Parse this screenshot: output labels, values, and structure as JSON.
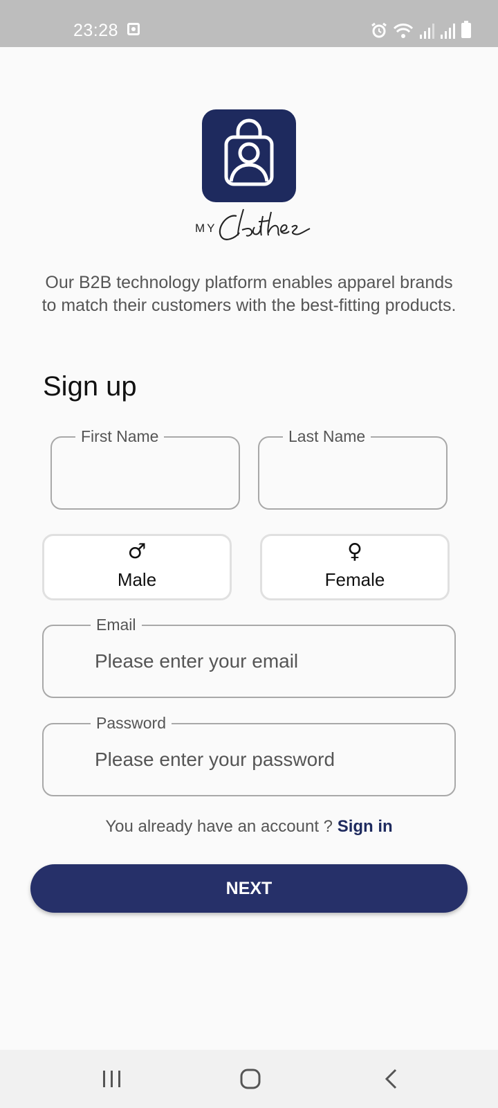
{
  "status_bar": {
    "time": "23:28",
    "icons": [
      "notification-icon",
      "alarm-icon",
      "wifi-icon",
      "signal-icon",
      "signal-icon",
      "battery-icon"
    ]
  },
  "brand": {
    "logo_icon": "shopping-bag-person-icon",
    "wordmark": "MY Clothes",
    "color": "#1e2a5e"
  },
  "tagline": "Our B2B technology platform enables apparel brands to match their customers with the best-fitting products.",
  "form": {
    "title": "Sign up",
    "first_name": {
      "label": "First Name",
      "value": ""
    },
    "last_name": {
      "label": "Last Name",
      "value": ""
    },
    "gender_options": [
      {
        "symbol": "♂",
        "label": "Male"
      },
      {
        "symbol": "♀",
        "label": "Female"
      }
    ],
    "email": {
      "label": "Email",
      "placeholder": "Please enter your email"
    },
    "password": {
      "label": "Password",
      "placeholder": "Please enter your password"
    },
    "signin_prompt": "You already have an account ?",
    "signin_link": "Sign in",
    "next_label": "NEXT",
    "button_color": "#263069"
  },
  "nav_bar": {
    "buttons": [
      "recents-icon",
      "home-icon",
      "back-icon"
    ]
  }
}
